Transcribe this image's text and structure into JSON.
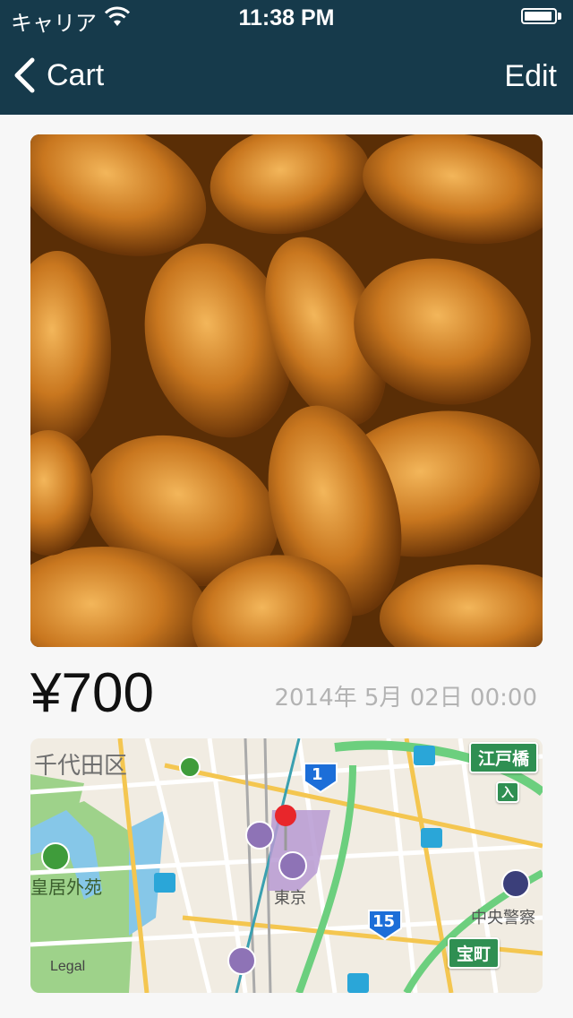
{
  "status_bar": {
    "carrier": "キャリア",
    "time": "11:38 PM"
  },
  "nav": {
    "back_label": "Cart",
    "edit_label": "Edit"
  },
  "item": {
    "price": "¥700",
    "date": "2014年 5月 02日 00:00"
  },
  "map": {
    "ward_label": "千代田区",
    "garden_label": "皇居外苑",
    "station_label": "東京",
    "police_label": "中央警察",
    "sign_edobashi": "江戸橋",
    "sign_takaracho": "宝町",
    "sign_entrance": "入",
    "route_1": "1",
    "route_15": "15",
    "legal": "Legal"
  },
  "colors": {
    "nav_bar": "#163a4b",
    "background": "#f7f7f7",
    "date_text": "#b3b3b3",
    "pin": "#e8262b"
  }
}
